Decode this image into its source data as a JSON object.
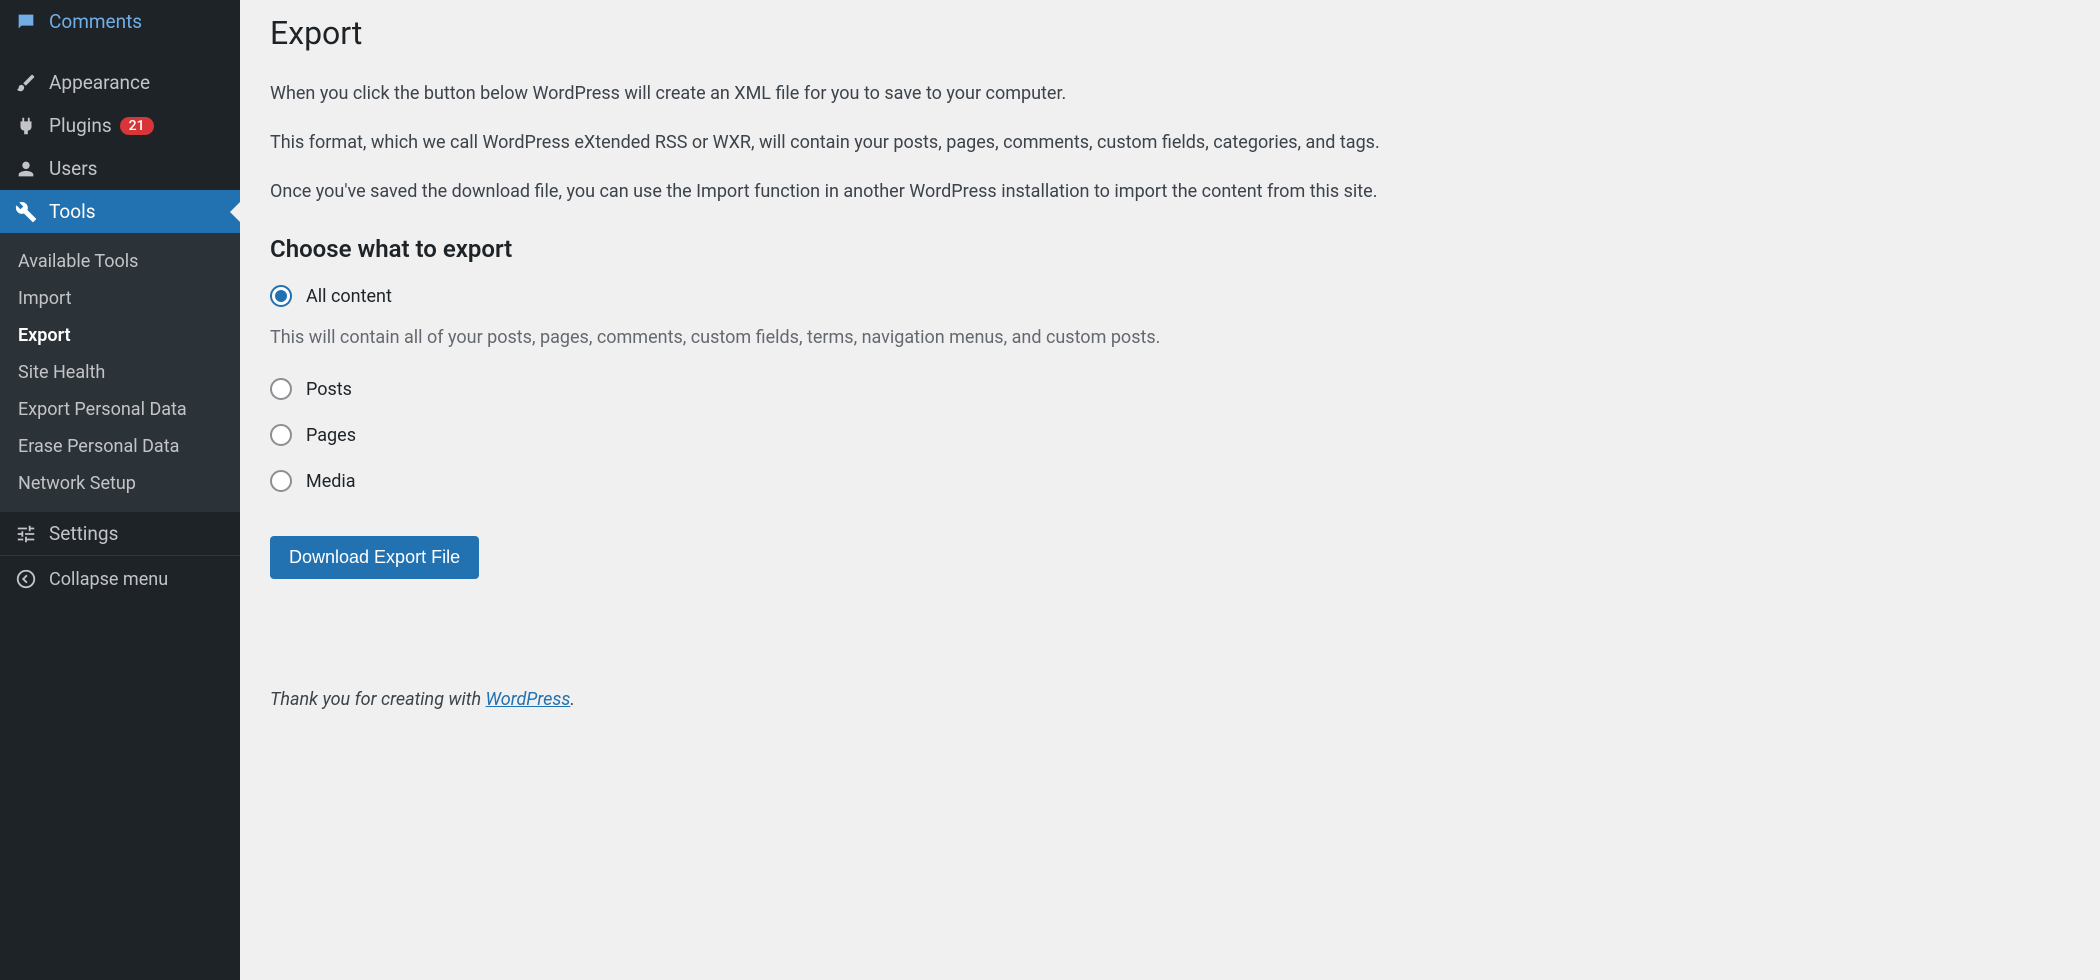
{
  "sidebar": {
    "items": [
      {
        "label": "Comments",
        "icon": "comment"
      },
      {
        "label": "Appearance",
        "icon": "brush"
      },
      {
        "label": "Plugins",
        "icon": "plugin",
        "badge": "21"
      },
      {
        "label": "Users",
        "icon": "user"
      },
      {
        "label": "Tools",
        "icon": "wrench",
        "active": true
      },
      {
        "label": "Settings",
        "icon": "settings"
      }
    ],
    "submenu": [
      {
        "label": "Available Tools"
      },
      {
        "label": "Import"
      },
      {
        "label": "Export",
        "current": true
      },
      {
        "label": "Site Health"
      },
      {
        "label": "Export Personal Data"
      },
      {
        "label": "Erase Personal Data"
      },
      {
        "label": "Network Setup"
      }
    ],
    "collapse_label": "Collapse menu"
  },
  "main": {
    "title": "Export",
    "paragraphs": [
      "When you click the button below WordPress will create an XML file for you to save to your computer.",
      "This format, which we call WordPress eXtended RSS or WXR, will contain your posts, pages, comments, custom fields, categories, and tags.",
      "Once you've saved the download file, you can use the Import function in another WordPress installation to import the content from this site."
    ],
    "section_heading": "Choose what to export",
    "radios": {
      "all_content": {
        "label": "All content",
        "description": "This will contain all of your posts, pages, comments, custom fields, terms, navigation menus, and custom posts."
      },
      "posts": {
        "label": "Posts"
      },
      "pages": {
        "label": "Pages"
      },
      "media": {
        "label": "Media"
      }
    },
    "download_button": "Download Export File",
    "footer_prefix": "Thank you for creating with ",
    "footer_link": "WordPress",
    "footer_suffix": "."
  }
}
